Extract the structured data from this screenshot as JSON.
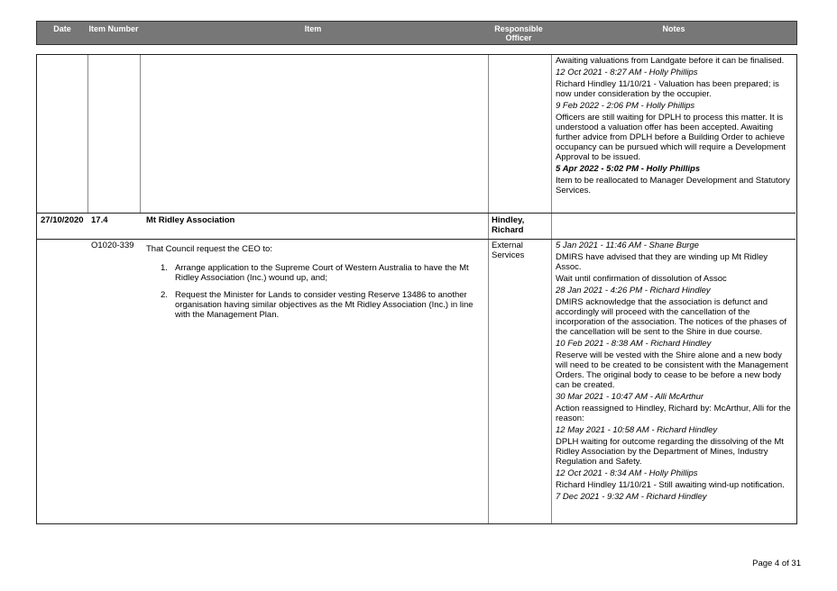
{
  "header": {
    "date": "Date",
    "item_number": "Item Number",
    "item": "Item",
    "responsible_officer": "Responsible Officer",
    "notes": "Notes"
  },
  "row1_notes": [
    {
      "style": "text",
      "text": "Awaiting valuations from Landgate before it can be finalised."
    },
    {
      "style": "ts",
      "text": "12 Oct 2021 - 8:27 AM - Holly Phillips"
    },
    {
      "style": "text",
      "text": "Richard Hindley 11/10/21 - Valuation has been prepared; is now under consideration by the occupier."
    },
    {
      "style": "ts",
      "text": "9 Feb 2022 - 2:06 PM - Holly Phillips"
    },
    {
      "style": "text",
      "text": "Officers are still waiting for DPLH to process this matter. It is understood a valuation offer has been accepted. Awaiting further advice from DPLH before a Building Order to achieve occupancy can be pursued which will require a Development Approval to be issued."
    },
    {
      "style": "tsb",
      "text": "5 Apr 2022 - 5:02 PM - Holly Phillips"
    },
    {
      "style": "text",
      "text": "Item to be reallocated to Manager Development and Statutory Services."
    }
  ],
  "section": {
    "date": "27/10/2020",
    "item_number": "17.4",
    "item": "Mt Ridley Association",
    "officer": "Hindley, Richard"
  },
  "row2": {
    "item_number": "O1020-339",
    "intro": "That Council request the CEO to:",
    "list": [
      {
        "n": "1.",
        "text": "Arrange application to the Supreme Court of Western Australia to have the Mt Ridley Association (Inc.) wound up, and;"
      },
      {
        "n": "2.",
        "text": "Request the Minister for Lands to consider vesting Reserve 13486 to another organisation having similar objectives as the Mt Ridley Association (Inc.) in line with the Management Plan."
      }
    ],
    "officer": "External Services",
    "notes": [
      {
        "style": "ts",
        "text": "5 Jan 2021 - 11:46 AM - Shane Burge"
      },
      {
        "style": "text",
        "text": "DMIRS have advised that they are winding up Mt Ridley Assoc."
      },
      {
        "style": "text",
        "text": "Wait until confirmation of dissolution of Assoc"
      },
      {
        "style": "ts",
        "text": "28 Jan 2021 - 4:26 PM - Richard Hindley"
      },
      {
        "style": "text",
        "text": "DMIRS acknowledge that the association is defunct and accordingly will proceed with the cancellation of the incorporation of the association. The notices of the phases of the cancellation will be sent to the Shire in due course."
      },
      {
        "style": "ts",
        "text": "10 Feb 2021 - 8:38 AM - Richard Hindley"
      },
      {
        "style": "text",
        "text": "Reserve will be vested with the Shire alone and a new body will need to be created to be consistent with the Management Orders. The original body to cease to be before a new body can be created."
      },
      {
        "style": "ts",
        "text": "30 Mar 2021 - 10:47 AM - Alli McArthur"
      },
      {
        "style": "text",
        "text": "Action reassigned to Hindley, Richard by: McArthur, Alli for the reason:"
      },
      {
        "style": "ts",
        "text": "12 May 2021 - 10:58 AM - Richard Hindley"
      },
      {
        "style": "text",
        "text": "DPLH waiting for outcome regarding the dissolving of the Mt Ridley Association by the Department of Mines, Industry Regulation and Safety."
      },
      {
        "style": "ts",
        "text": "12 Oct 2021 - 8:34 AM - Holly Phillips"
      },
      {
        "style": "text",
        "text": "Richard Hindley 11/10/21 - Still awaiting wind-up notification."
      },
      {
        "style": "ts",
        "text": "7 Dec 2021 - 9:32 AM - Richard Hindley"
      }
    ]
  },
  "footer": "Page 4 of 31"
}
